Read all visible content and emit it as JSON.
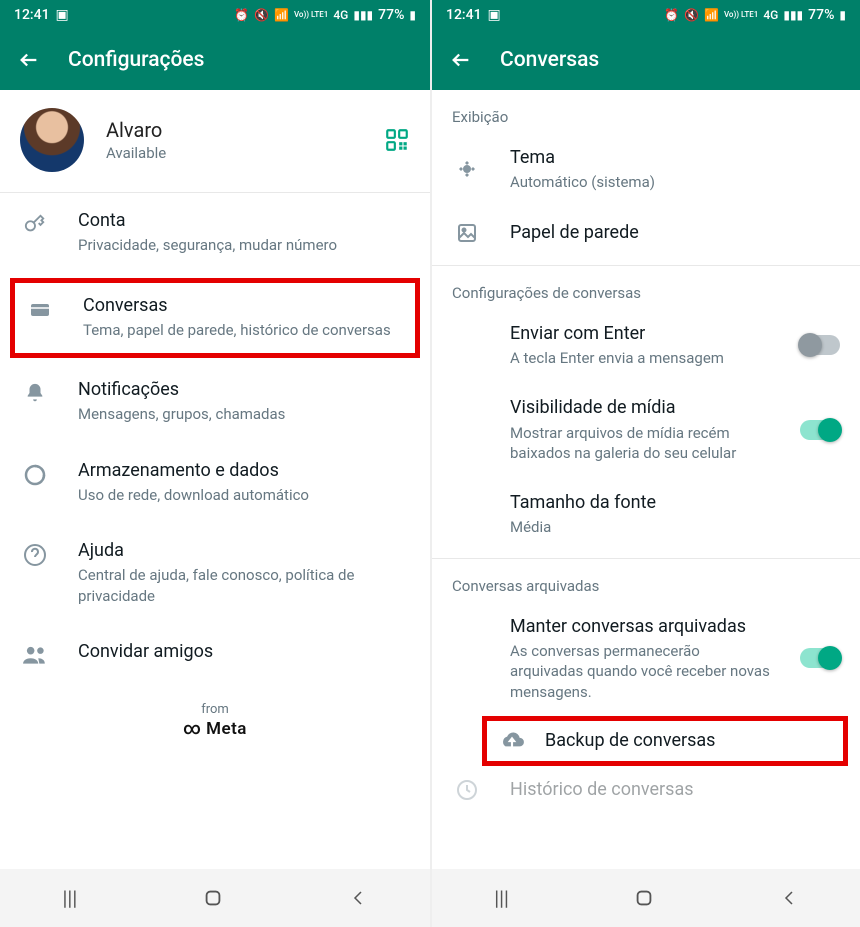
{
  "status": {
    "time": "12:41",
    "battery": "77%",
    "net": "4G",
    "lte": "Vo)) LTE1"
  },
  "left": {
    "header_title": "Configurações",
    "profile": {
      "name": "Alvaro",
      "status": "Available"
    },
    "items": {
      "account": {
        "title": "Conta",
        "sub": "Privacidade, segurança, mudar número"
      },
      "chats": {
        "title": "Conversas",
        "sub": "Tema, papel de parede, histórico de conversas"
      },
      "notif": {
        "title": "Notificações",
        "sub": "Mensagens, grupos, chamadas"
      },
      "storage": {
        "title": "Armazenamento e dados",
        "sub": "Uso de rede, download automático"
      },
      "help": {
        "title": "Ajuda",
        "sub": "Central de ajuda, fale conosco, política de privacidade"
      },
      "invite": {
        "title": "Convidar amigos"
      }
    },
    "brand_from": "from",
    "brand_meta": "Meta"
  },
  "right": {
    "header_title": "Conversas",
    "display_label": "Exibição",
    "theme": {
      "title": "Tema",
      "sub": "Automático (sistema)"
    },
    "wallpaper": {
      "title": "Papel de parede"
    },
    "chat_settings_label": "Configurações de conversas",
    "enter": {
      "title": "Enviar com Enter",
      "sub": "A tecla Enter envia a mensagem"
    },
    "media": {
      "title": "Visibilidade de mídia",
      "sub": "Mostrar arquivos de mídia recém baixados na galeria do seu celular"
    },
    "font": {
      "title": "Tamanho da fonte",
      "sub": "Média"
    },
    "archived_label": "Conversas arquivadas",
    "keep_archived": {
      "title": "Manter conversas arquivadas",
      "sub": "As conversas permanecerão arquivadas quando você receber novas mensagens."
    },
    "backup": {
      "title": "Backup de conversas"
    },
    "history": {
      "title": "Histórico de conversas"
    }
  }
}
